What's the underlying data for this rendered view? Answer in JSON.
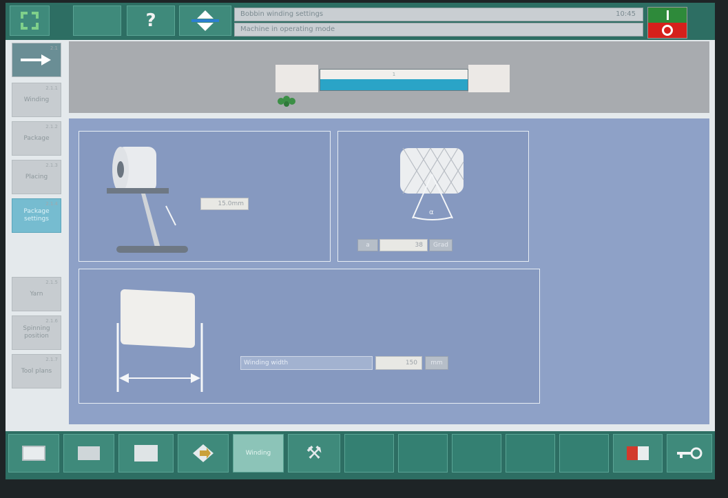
{
  "topbar": {
    "messages": [
      "Bobbin winding settings",
      "Machine in operating mode"
    ],
    "message_right": "10:45"
  },
  "sidebar": {
    "items": [
      {
        "label": "",
        "num": "2.1"
      },
      {
        "label": "Winding",
        "num": "2.1.1"
      },
      {
        "label": "Package",
        "num": "2.1.2"
      },
      {
        "label": "Placing",
        "num": "2.1.3"
      },
      {
        "label": "Package settings",
        "num": "2.1.4"
      },
      {
        "label": "Yarn",
        "num": "2.1.5"
      },
      {
        "label": "Spinning position",
        "num": "2.1.6"
      },
      {
        "label": "Tool plans",
        "num": "2.1.7"
      }
    ]
  },
  "header": {
    "bar_label": "1"
  },
  "tension_panel": {
    "value": "15.0mm"
  },
  "angle_panel": {
    "prefix": "a",
    "value": "38",
    "unit": "Grad"
  },
  "width_panel": {
    "label": "Winding width",
    "value": "150",
    "unit": "mm"
  },
  "bottombar": {
    "active_label": "Winding"
  }
}
